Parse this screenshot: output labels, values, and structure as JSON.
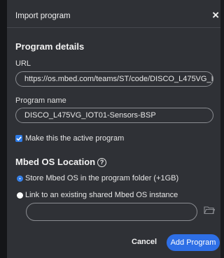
{
  "dialog": {
    "title": "Import program",
    "close_glyph": "×"
  },
  "program_details": {
    "heading": "Program details",
    "url_label": "URL",
    "url_value": "https://os.mbed.com/teams/ST/code/DISCO_L475VG_I",
    "name_label": "Program name",
    "name_value": "DISCO_L475VG_IOT01-Sensors-BSP",
    "make_active_label": "Make this the active program",
    "make_active_checked": true
  },
  "mbed_os_location": {
    "heading": "Mbed OS Location",
    "help_glyph": "?",
    "options": [
      {
        "label": "Store Mbed OS in the program folder (+1GB)",
        "selected": true
      },
      {
        "label": "Link to an existing shared Mbed OS instance",
        "selected": false
      }
    ],
    "shared_path_value": ""
  },
  "footer": {
    "cancel_label": "Cancel",
    "add_label": "Add Program"
  },
  "colors": {
    "accent": "#2e6fe6",
    "dialog_bg": "#2f3136",
    "text": "#e6e6e6"
  }
}
